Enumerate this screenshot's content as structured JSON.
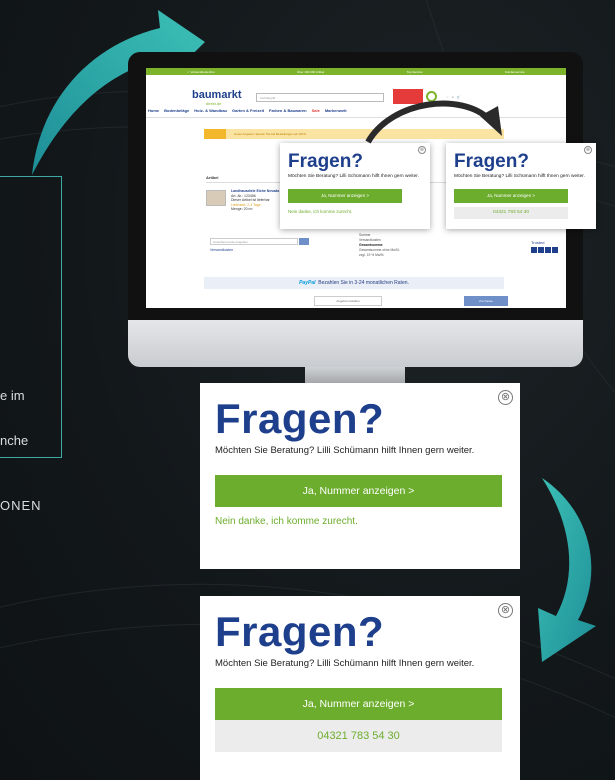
{
  "left_panel": {
    "line1": "e im",
    "line2": "nche",
    "caps": "ONEN"
  },
  "site": {
    "topbar": [
      "✓ Versandkostenfrei",
      "Über 100.000 Artikel",
      "Top-Service",
      "Kundenservice"
    ],
    "logo": "baumarkt",
    "logo_sub": "direkt.de",
    "search_placeholder": "Suchbegriff...",
    "nav": [
      "Home",
      "Bodenbeläge",
      "Holz- & Wandbau",
      "Garten & Freizeit",
      "Farben & Bauwaren",
      "Sale",
      "Markenwelt"
    ],
    "promo": "Unser Angebot: Sparen Sie bei Bestellungen ab 100 €",
    "artikel_label": "Artikel",
    "product_lines": [
      "Landhausdiele Eiche Nevada",
      "Art.-Nr.: 123456",
      "Dieser Artikel ist lieferbar",
      "Lieferzeit: 2-3 Tage",
      "Menge: 20 m²"
    ],
    "coupon_placeholder": "Gutschein-Code eingeben",
    "coupon_link": "Versandkosten",
    "summary": [
      {
        "label": "Summe",
        "value": "",
        "bold": false
      },
      {
        "label": "Versandkosten",
        "value": "",
        "bold": false
      },
      {
        "label": "Gesamtsumme",
        "value": "",
        "bold": true
      },
      {
        "label": "Gesamtsumme ohne MwSt.",
        "value": "",
        "bold": false
      },
      {
        "label": "zzgl. 19 % MwSt.",
        "value": "",
        "bold": false
      }
    ],
    "trust_label": "Trusted",
    "paypal_brand": "PayPal",
    "paypal_text": "Bezahlen Sie in 3-24 monatlichen Raten.",
    "btn_offer": "Angebot erstellen",
    "btn_checkout": "Zur Kasse"
  },
  "popup": {
    "title": "Fragen?",
    "subtitle": "Möchten Sie Beratung? Lilli Schümann hilft Ihnen gern weiter.",
    "button_label": "Ja, Nummer anzeigen >",
    "decline_label": "Nein danke, ich komme zurecht.",
    "phone_number": "04321 783 54 30",
    "close_glyph": "⊗"
  },
  "colors": {
    "brand_blue": "#1e3f8c",
    "brand_green": "#6dad2e",
    "accent_teal": "#3fb0b0",
    "background": "#12171a"
  }
}
